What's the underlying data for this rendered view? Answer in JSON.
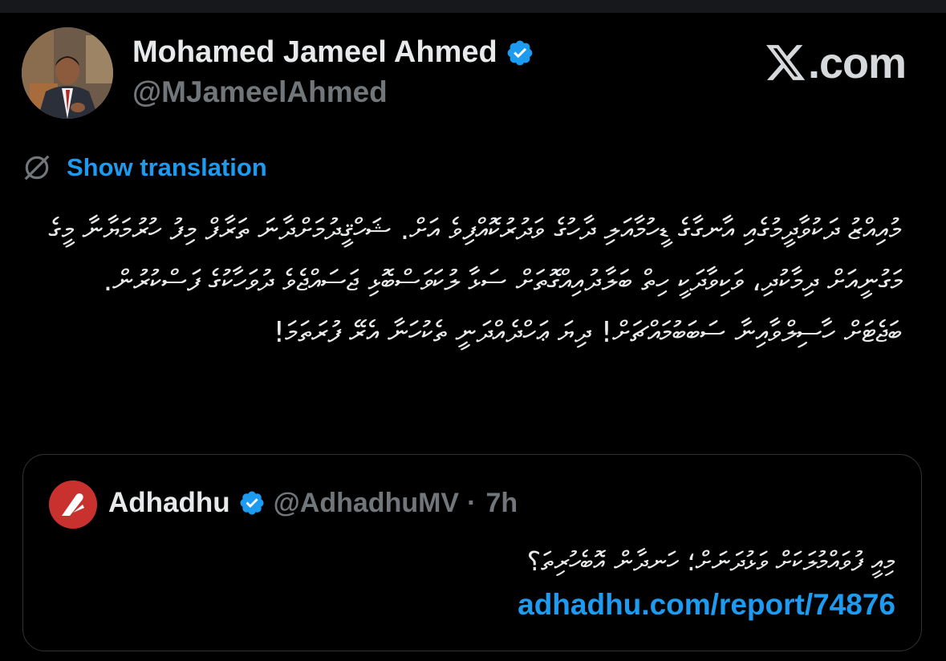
{
  "brand": {
    "text": ".com",
    "icon": "x-logo-icon"
  },
  "author": {
    "name": "Mohamed Jameel Ahmed",
    "handle": "@MJameelAhmed",
    "verified": true,
    "avatar_icon": "person-portrait-avatar"
  },
  "translation": {
    "label": "Show translation",
    "icon": "translate-globe-icon"
  },
  "tweet": {
    "text": "މުއިއްޒު ދަކުވާދީމުގެއި އާނގާގެ ޑީހުމާއަލި ދާހުގެ ވަދުރުކޮއްފިވެ އަށް. ޝަހްޤީދުމަށްދާނަ ތަރާފް މިފު ހުރުމަޔާނާ މީގެ މަގުނީއަށް ދިމާކުދި، ވަކިވާދަކީ ހިތް ބަލާދުއިއްގޮތަށް ސަޅާ ލުކަވަސްބޮޅި ޖަސައްޖެވެ ދުވަހާކުގެ ފަސްކުރުން. ބަޖެޓަށް ހާސިލްވާއިނާ ސަބަބުމައްޗަށް! ދިޔަ ޢަހްދެއްދަނީ ތެކުހަނާ އެރޭ ފުރަތަމަ!"
  },
  "quote": {
    "name": "Adhadhu",
    "handle": "@AdhadhuMV",
    "separator": "·",
    "time": "7h",
    "verified": true,
    "text": "މިއީ ފުވައްމުލަކަށް ވަޅުދަނަށް؛ ހަނދާން އޮބެހުރިތަ؟",
    "link": "adhadhu.com/report/74876"
  },
  "colors": {
    "background": "#000000",
    "text": "#e7e9ea",
    "muted": "#71767b",
    "link": "#1d9bf0",
    "verified": "#1d9bf0",
    "card_border": "#2f3336",
    "adhadhu_red": "#c8312e"
  }
}
